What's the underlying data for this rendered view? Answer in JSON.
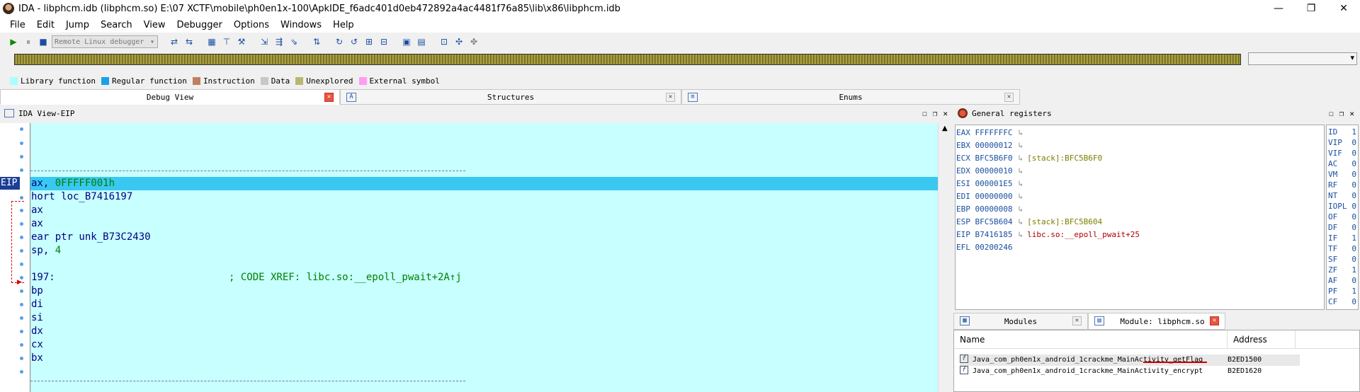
{
  "window": {
    "title": "IDA - libphcm.idb (libphcm.so) E:\\07 XCTF\\mobile\\ph0en1x-100\\ApkIDE_f6adc401d0eb472892a4ac4481f76a85\\lib\\x86\\libphcm.idb",
    "minimize": "—",
    "restore": "❐",
    "close": "✕"
  },
  "menu": [
    "File",
    "Edit",
    "Jump",
    "Search",
    "View",
    "Debugger",
    "Options",
    "Windows",
    "Help"
  ],
  "toolbar": {
    "debugger_select": "Remote Linux debugger"
  },
  "legend": [
    {
      "label": "Library function",
      "color": "#a8ffff"
    },
    {
      "label": "Regular function",
      "color": "#1aa0e8"
    },
    {
      "label": "Instruction",
      "color": "#c08060"
    },
    {
      "label": "Data",
      "color": "#c8c8c8"
    },
    {
      "label": "Unexplored",
      "color": "#b8b870"
    },
    {
      "label": "External symbol",
      "color": "#ff9cf0"
    }
  ],
  "tabs": [
    "Debug View",
    "Structures",
    "Enums"
  ],
  "ida_view": {
    "title": "IDA View-EIP",
    "eip_tag": "EIP",
    "lines": [
      {
        "text": "ax, ",
        "num": "0FFFFF001h"
      },
      {
        "text": "hort loc_B7416197"
      },
      {
        "text": "ax"
      },
      {
        "text": "ax"
      },
      {
        "text": "ear ptr unk_B73C2430"
      },
      {
        "text": "sp, ",
        "num": "4"
      },
      {
        "text": ""
      },
      {
        "text": "197:",
        "comment": "; CODE XREF: libc.so:__epoll_pwait+2A↑j"
      },
      {
        "text": "bp"
      },
      {
        "text": "di"
      },
      {
        "text": "si"
      },
      {
        "text": "dx"
      },
      {
        "text": "cx"
      },
      {
        "text": "bx"
      }
    ]
  },
  "registers": {
    "title": "General registers",
    "items": [
      {
        "name": "EAX",
        "value": "FFFFFFFC",
        "arrow": "↳",
        "ann": ""
      },
      {
        "name": "EBX",
        "value": "00000012",
        "arrow": "↳",
        "ann": ""
      },
      {
        "name": "ECX",
        "value": "BFC5B6F0",
        "arrow": "↳",
        "ann": "[stack]:BFC5B6F0"
      },
      {
        "name": "EDX",
        "value": "00000010",
        "arrow": "↳",
        "ann": ""
      },
      {
        "name": "ESI",
        "value": "000001E5",
        "arrow": "↳",
        "ann": ""
      },
      {
        "name": "EDI",
        "value": "00000000",
        "arrow": "↳",
        "ann": ""
      },
      {
        "name": "EBP",
        "value": "00000008",
        "arrow": "↳",
        "ann": ""
      },
      {
        "name": "ESP",
        "value": "BFC5B604",
        "arrow": "↳",
        "ann": "[stack]:BFC5B604"
      },
      {
        "name": "EIP",
        "value": "B7416185",
        "arrow": "↳",
        "ann": "libc.so:__epoll_pwait+25"
      },
      {
        "name": "EFL",
        "value": "00200246",
        "arrow": "",
        "ann": ""
      }
    ],
    "flags": [
      {
        "name": "ID",
        "value": "1"
      },
      {
        "name": "VIP",
        "value": "0"
      },
      {
        "name": "VIF",
        "value": "0"
      },
      {
        "name": "AC",
        "value": "0"
      },
      {
        "name": "VM",
        "value": "0"
      },
      {
        "name": "RF",
        "value": "0"
      },
      {
        "name": "NT",
        "value": "0"
      },
      {
        "name": "IOPL",
        "value": "0"
      },
      {
        "name": "OF",
        "value": "0"
      },
      {
        "name": "DF",
        "value": "0"
      },
      {
        "name": "IF",
        "value": "1"
      },
      {
        "name": "TF",
        "value": "0"
      },
      {
        "name": "SF",
        "value": "0"
      },
      {
        "name": "ZF",
        "value": "1"
      },
      {
        "name": "AF",
        "value": "0"
      },
      {
        "name": "PF",
        "value": "1"
      },
      {
        "name": "CF",
        "value": "0"
      }
    ]
  },
  "modules": {
    "tabs": [
      "Modules",
      "Module: libphcm.so"
    ],
    "columns": [
      "Name",
      "Address"
    ],
    "rows": [
      {
        "name": "Java_com_ph0en1x_android_1crackme_MainActivity_getFlag",
        "address": "B2ED1500"
      },
      {
        "name": "Java_com_ph0en1x_android_1crackme_MainActivity_encrypt",
        "address": "B2ED1620"
      }
    ]
  }
}
